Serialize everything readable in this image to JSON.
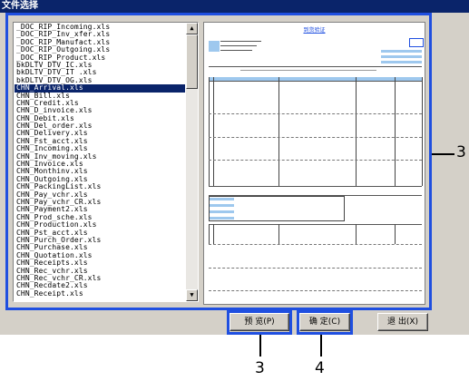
{
  "window": {
    "title": "文件选择"
  },
  "file_list": {
    "items": [
      "_DOC_RIP_Incoming.xls",
      "_DOC_RIP_Inv_xfer.xls",
      "_DOC_RIP_Manufact.xls",
      "_DOC_RIP_Outgoing.xls",
      "_DOC_RIP_Product.xls",
      "bkDLTV_DTV_IC.xls",
      "bkDLTV_DTV_IT .xls",
      "bkDLTV_DTV_OG.xls",
      "CHN_Arrival.xls",
      "CHN_Bill.xls",
      "CHN_Credit.xls",
      "CHN_D_invoice.xls",
      "CHN_Debit.xls",
      "CHN_Del_order.xls",
      "CHN_Delivery.xls",
      "CHN_Fst_acct.xls",
      "CHN_Incoming.xls",
      "CHN_Inv_moving.xls",
      "CHN_Invoice.xls",
      "CHN_Monthinv.xls",
      "CHN_Outgoing.xls",
      "CHN_PackingList.xls",
      "CHN_Pay_vchr.xls",
      "CHN_Pay_vchr_CR.xls",
      "CHN_Payment2.xls",
      "CHN_Prod_sche.xls",
      "CHN_Production.xls",
      "CHN_Pst_acct.xls",
      "CHN_Purch_Order.xls",
      "CHN_Purchase.xls",
      "CHN_Quotation.xls",
      "CHN_Receipts.xls",
      "CHN_Rec_vchr.xls",
      "CHN_Rec_vchr_CR.xls",
      "CHN_Recdate2.xls",
      "CHN_Receipt.xls"
    ],
    "selected": "CHN_Arrival.xls"
  },
  "preview": {
    "doc_title": "到货验证"
  },
  "buttons": {
    "preview": "预 览(P)",
    "ok": "确 定(C)",
    "exit": "退 出(X)"
  },
  "callouts": {
    "right": "3",
    "bottom_left": "3",
    "bottom_right": "4"
  },
  "colors": {
    "highlight": "#1f4fe0",
    "selection": "#0a246a",
    "window_bg": "#d4d0c8"
  }
}
